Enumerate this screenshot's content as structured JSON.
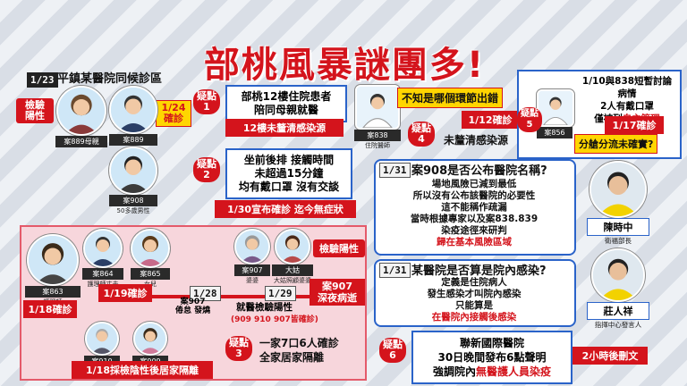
{
  "title": "部桃風暴謎團多!",
  "panel_top_left": {
    "date": "1/23",
    "headline": "平鎮某醫院同候診區",
    "tag_positive": "檢驗\n陽性",
    "tag_124": "1/24\n確診",
    "case889_mother": "案889母親",
    "case889": "案889",
    "case908": "案908",
    "case908_desc": "50多歲男性"
  },
  "suspicion1": {
    "badge": "疑點\n1",
    "line1": "部桃12樓住院患者",
    "line2": "陪同母親就醫",
    "bar": "12樓未釐清感染源"
  },
  "suspicion2": {
    "badge": "疑點\n2",
    "line1": "坐前後排 接觸時間",
    "line2": "未超過15分鐘",
    "line3": "均有戴口罩 沒有交談",
    "bar": "1/30宣布確診 迄今無症狀"
  },
  "suspicion4": {
    "badge": "疑點\n4",
    "question": "不知是哪個環節出錯",
    "case": "案838",
    "case_desc": "住院醫師",
    "date_tag": "1/12確診",
    "note": "未釐清感染源"
  },
  "suspicion5": {
    "badge": "疑點\n5",
    "line1": "1/10與838短暫討論病情",
    "line2": "2人有戴口罩",
    "line3_pre": "僅被列",
    "line3_red": "自主管理",
    "case": "案856",
    "date_tag": "1/17確診",
    "note": "分艙分流未確實?"
  },
  "q1": {
    "date": "1/31",
    "title": "案908是否公布醫院名稱?",
    "lines": [
      "場地風險已減到最低",
      "所以沒有公布該醫院的必要性",
      "這不能稱作疏漏",
      "當時根據專家以及案838.839",
      "染疫途徑來研判"
    ],
    "last_line": "歸在基本風險區域",
    "official": "陳時中",
    "official_title": "衛福部長"
  },
  "q2": {
    "date": "1/31",
    "title": "某醫院是否算是院內感染?",
    "line1": "定義是住院病人",
    "line2": "發生感染才叫院內感染",
    "line3": "只能算是",
    "line4": "在醫院內接觸後感染",
    "official": "莊人祥",
    "official_title": "指揮中心發言人"
  },
  "family": {
    "case863": "案863",
    "case863_desc": "護理師",
    "date_118": "1/18確診",
    "case864": "案864",
    "case864_desc": "護理師丈夫",
    "case865": "案865",
    "case865_desc": "女兒",
    "date_119": "1/19確診",
    "case907": "案907",
    "case907_desc": "婆婆",
    "sister": "大姑",
    "sister_desc": "大姑照顧婆婆",
    "tag_positive": "檢驗陽性",
    "date_128": "1/28",
    "death_note": "案907\n倦怠 發燒",
    "date_129": "1/29",
    "after_death": "就醫檢驗陽性",
    "after_death_sub": "(909  910 907皆確診)",
    "death_box": "案907\n深夜病逝",
    "case910": "案910",
    "case910_desc": "公公",
    "case909": "案909",
    "case909_desc": "女兒",
    "isolation_bar": "1/18採檢陰性後居家隔離",
    "suspicion3_badge": "疑點\n3",
    "suspicion3_line1": "一家7口6人確診",
    "suspicion3_line2": "全家居家隔離"
  },
  "suspicion6": {
    "badge": "疑點\n6",
    "line1": "聯新國際醫院",
    "line2": "30日晚間發布6點聲明",
    "line3_pre": "強調院內",
    "line3_red": "無醫護人員染疫",
    "note": "2小時後刪文"
  },
  "colors": {
    "accent_red": "#d4141c",
    "accent_blue": "#2a63c9",
    "highlight_yellow": "#ffd500",
    "pink_panel": "#f7d6dc"
  }
}
